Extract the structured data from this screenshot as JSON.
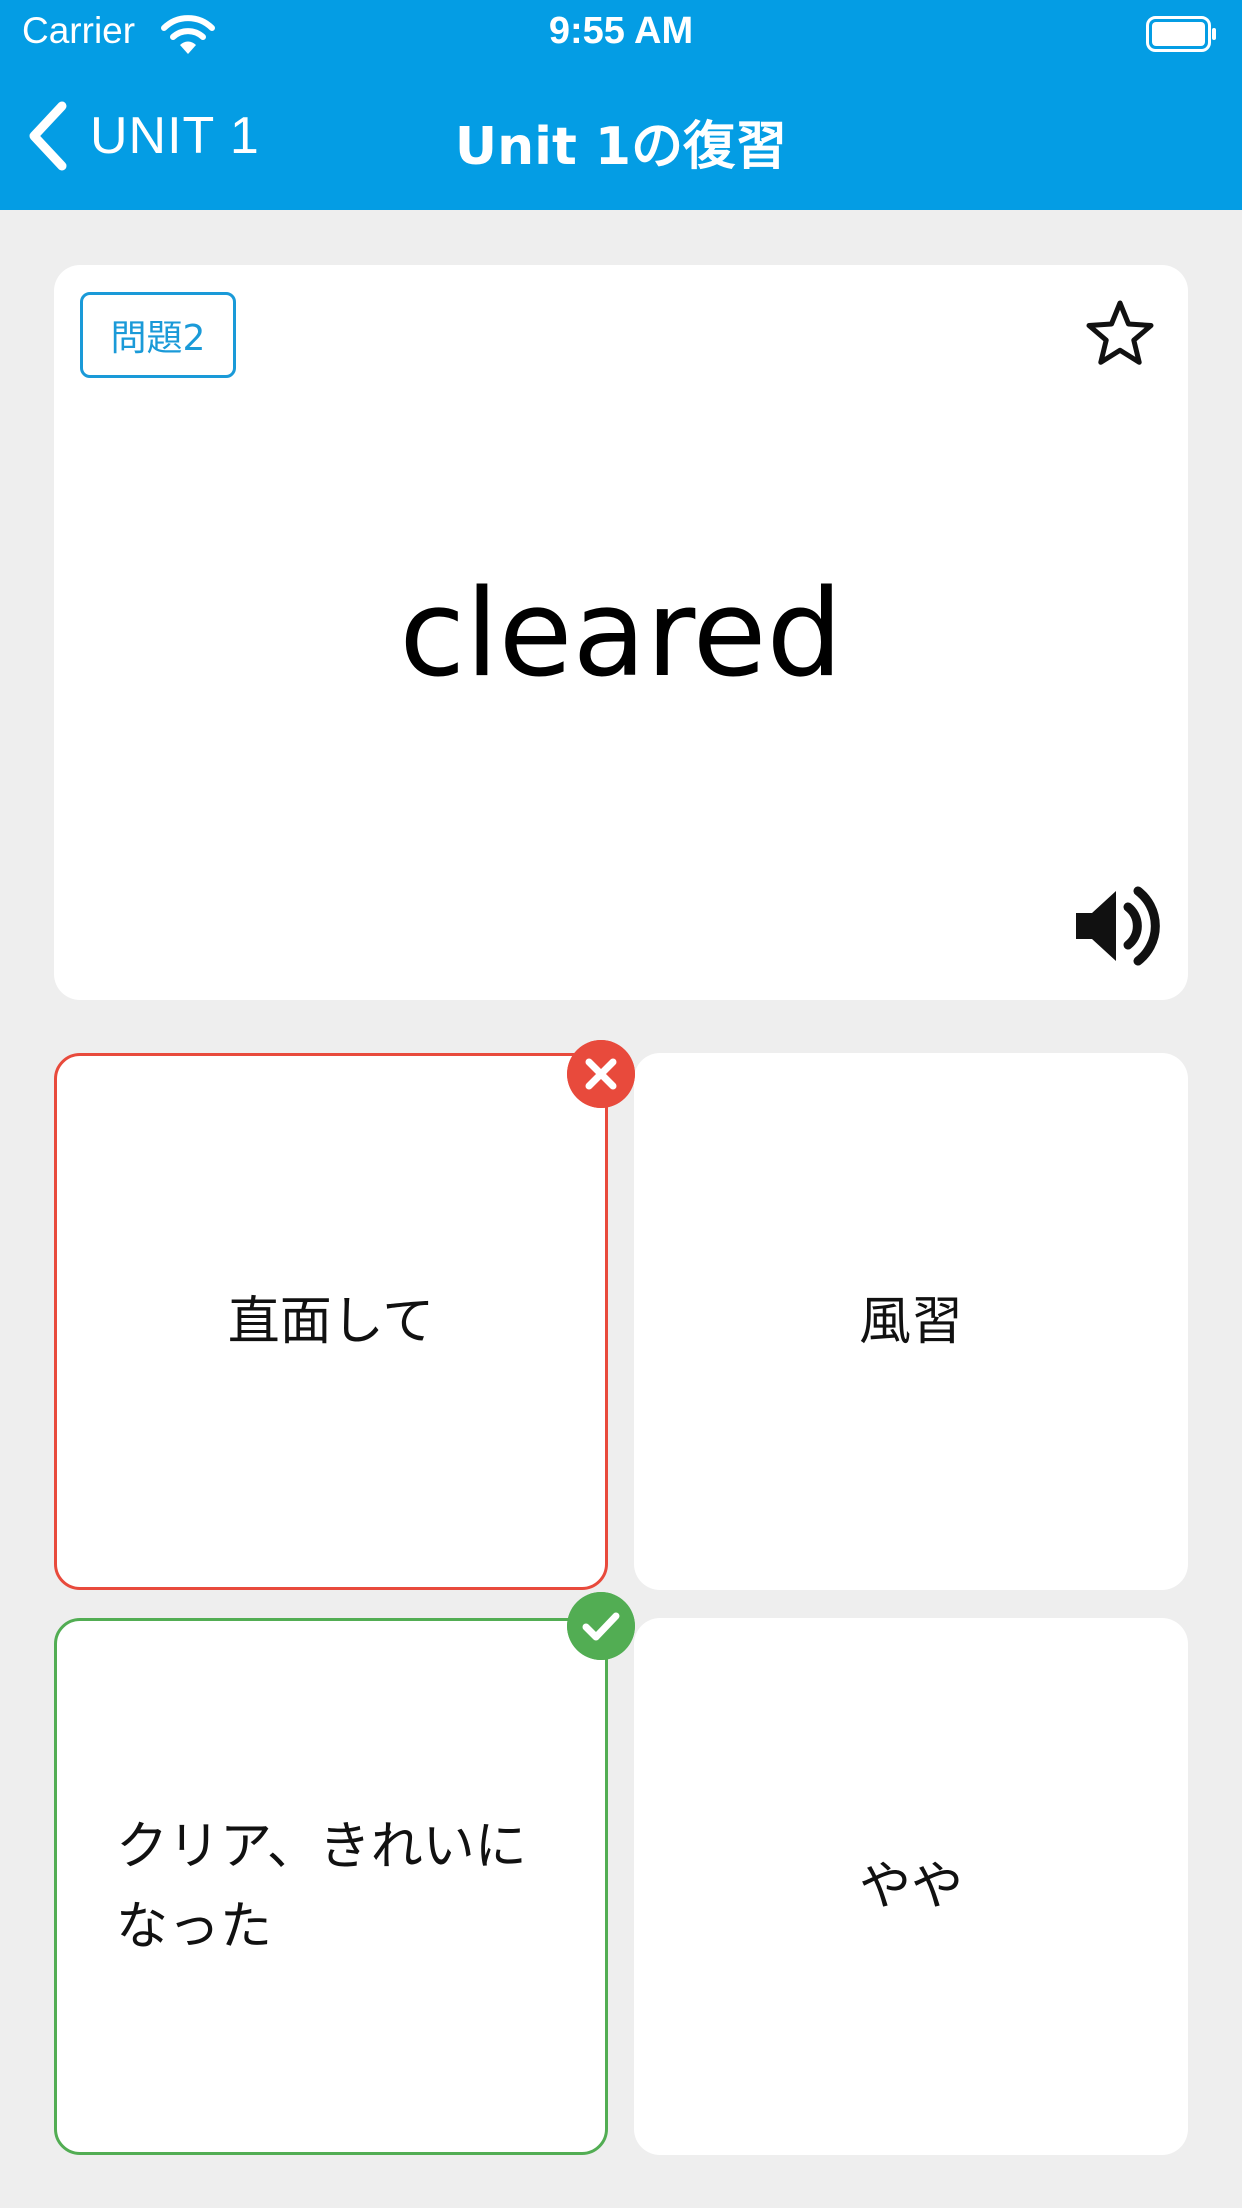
{
  "status_bar": {
    "carrier": "Carrier",
    "time": "9:55 AM"
  },
  "nav": {
    "back_label": "UNIT 1",
    "title": "Unit 1の復習"
  },
  "question": {
    "badge": "問題2",
    "word": "cleared"
  },
  "choices": [
    {
      "label": "直面して",
      "state": "wrong"
    },
    {
      "label": "風習",
      "state": "none"
    },
    {
      "label": "クリア、きれいになった",
      "state": "correct"
    },
    {
      "label": "やや",
      "state": "none"
    }
  ],
  "icons": {
    "back": "chevron-left-icon",
    "favorite": "star-outline-icon",
    "audio": "speaker-icon",
    "wrong": "x-circle-icon",
    "correct": "check-circle-icon"
  },
  "colors": {
    "header": "#049de4",
    "accent": "#1a9ad8",
    "wrong": "#e84a3c",
    "correct": "#52ad53",
    "background": "#eeeeee"
  }
}
